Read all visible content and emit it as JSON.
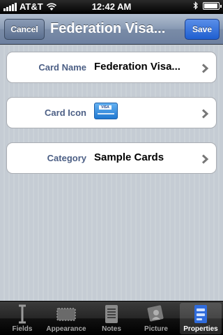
{
  "status_bar": {
    "carrier": "AT&T",
    "time": "12:42 AM",
    "wifi_icon": "wifi-icon",
    "bluetooth_icon": "bluetooth-icon",
    "battery_icon": "battery-icon",
    "battery_level": 0.95
  },
  "nav": {
    "cancel_label": "Cancel",
    "title": "Federation Visa...",
    "save_label": "Save"
  },
  "rows": [
    {
      "label": "Card Name",
      "value": "Federation Visa..."
    },
    {
      "label": "Card Icon",
      "icon": "visa-card-icon",
      "icon_text": "VISA"
    },
    {
      "label": "Category",
      "value": "Sample Cards"
    }
  ],
  "tabs": [
    {
      "label": "Fields",
      "icon": "text-cursor-icon"
    },
    {
      "label": "Appearance",
      "icon": "card-outline-icon"
    },
    {
      "label": "Notes",
      "icon": "notes-icon"
    },
    {
      "label": "Picture",
      "icon": "picture-icon"
    },
    {
      "label": "Properties",
      "icon": "properties-icon",
      "selected": true
    }
  ],
  "colors": {
    "nav_bar": "#7a8ca7",
    "save_button": "#2a6ad9",
    "label_text": "#4c5f85",
    "selected_tab": "#2f6bdc"
  }
}
